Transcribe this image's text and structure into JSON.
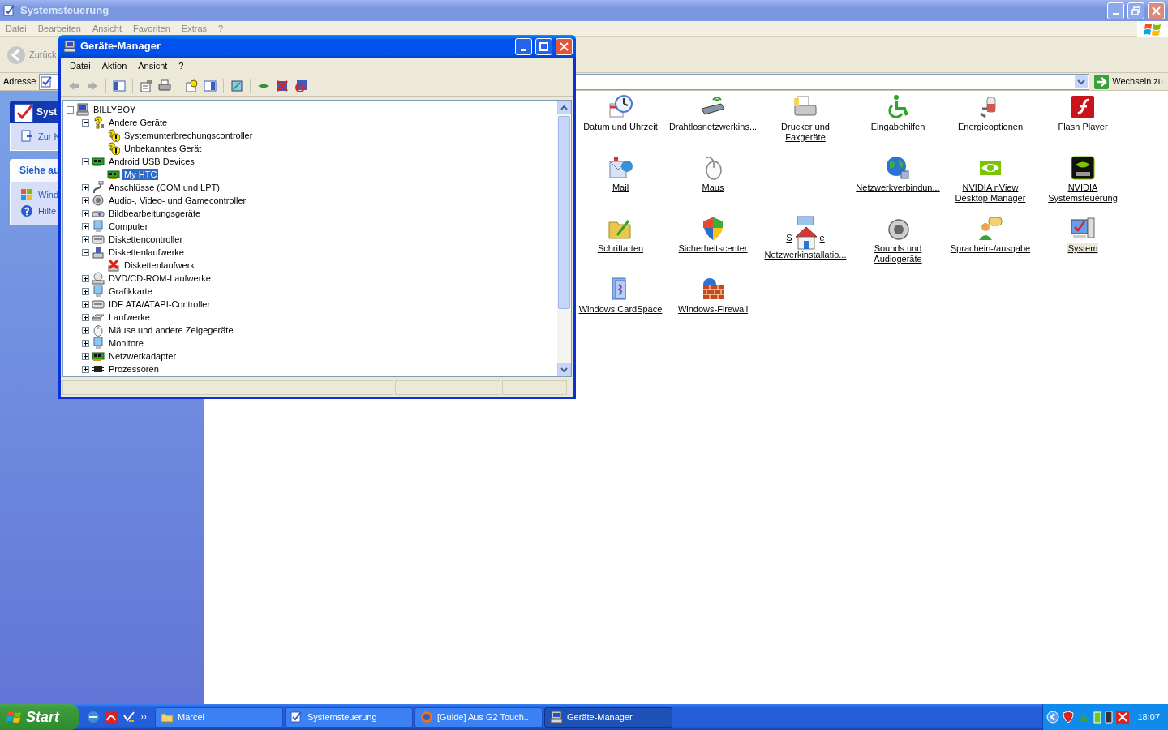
{
  "explorer": {
    "title": "Systemsteuerung",
    "menu": [
      "Datei",
      "Bearbeiten",
      "Ansicht",
      "Favoriten",
      "Extras",
      "?"
    ],
    "back_button": {
      "label": "Zurück",
      "disabled": true
    },
    "address": {
      "label": "Adresse",
      "go_button": "Wechseln zu"
    },
    "task_panes": [
      {
        "kind": "special",
        "title": "Syst",
        "links": [
          "Zur K"
        ]
      },
      {
        "kind": "normal",
        "title": "Siehe au",
        "links": [
          "Wind",
          "Hilfe"
        ]
      }
    ],
    "items": [
      {
        "kind": "item",
        "label": "Datum und Uhrzeit",
        "selected": false
      },
      {
        "kind": "item",
        "label": "Drahtlosnetzwerkins...",
        "selected": false
      },
      {
        "kind": "item",
        "label": "Drucker und Faxgeräte",
        "selected": false
      },
      {
        "kind": "item",
        "label": "Eingabehilfen",
        "selected": false
      },
      {
        "kind": "item",
        "label": "Energieoptionen",
        "selected": false
      },
      {
        "kind": "item",
        "label": "Flash Player",
        "selected": false
      },
      {
        "kind": "item",
        "label": "Mail",
        "selected": false
      },
      {
        "kind": "item",
        "label": "Maus",
        "selected": false
      },
      {
        "kind": "blank"
      },
      {
        "kind": "item",
        "label": "Netzwerkverbindun...",
        "selected": false
      },
      {
        "kind": "item",
        "label": "NVIDIA nView Desktop Manager",
        "selected": false
      },
      {
        "kind": "item",
        "label": "NVIDIA Systemsteuerung",
        "selected": false
      },
      {
        "kind": "item",
        "label": "Schriftarten",
        "selected": false
      },
      {
        "kind": "item",
        "label": "Sicherheitscenter",
        "selected": false
      },
      {
        "kind": "covered",
        "label_parts": [
          "S",
          "e"
        ],
        "caption": "Netzwerkinstallatio..."
      },
      {
        "kind": "item",
        "label": "Sounds und Audiogeräte",
        "selected": false
      },
      {
        "kind": "item",
        "label": "Sprachein-/ausgabe",
        "selected": false
      },
      {
        "kind": "item",
        "label": "System",
        "selected": true
      },
      {
        "kind": "item",
        "label": "Windows CardSpace",
        "selected": false
      },
      {
        "kind": "item",
        "label": "Windows-Firewall",
        "selected": false
      }
    ]
  },
  "device_manager": {
    "title": "Geräte-Manager",
    "menu": [
      "Datei",
      "Aktion",
      "Ansicht",
      "?"
    ],
    "nav_buttons": [
      {
        "disabled": true
      },
      {
        "disabled": true
      }
    ],
    "tree": {
      "label": "BILLYBOY",
      "kind": "computer",
      "expanded": true,
      "selected": false,
      "children": [
        {
          "label": "Andere Geräte",
          "kind": "unknown",
          "expanded": true,
          "selected": false,
          "children": [
            {
              "label": "Systemunterbrechungscontroller",
              "kind": "warning",
              "selected": false
            },
            {
              "label": "Unbekanntes Gerät",
              "kind": "warning",
              "selected": false
            }
          ]
        },
        {
          "label": "Android USB Devices",
          "kind": "board",
          "expanded": true,
          "selected": false,
          "children": [
            {
              "label": "My HTC",
              "kind": "board",
              "selected": true
            }
          ]
        },
        {
          "label": "Anschlüsse (COM und LPT)",
          "kind": "port",
          "expanded": false,
          "selected": false
        },
        {
          "label": "Audio-, Video- und Gamecontroller",
          "kind": "audio",
          "expanded": false,
          "selected": false
        },
        {
          "label": "Bildbearbeitungsgeräte",
          "kind": "camera",
          "expanded": false,
          "selected": false
        },
        {
          "label": "Computer",
          "kind": "monitor",
          "expanded": false,
          "selected": false
        },
        {
          "label": "Diskettencontroller",
          "kind": "controller",
          "expanded": false,
          "selected": false
        },
        {
          "label": "Diskettenlaufwerke",
          "kind": "floppy",
          "expanded": true,
          "selected": false,
          "children": [
            {
              "label": "Diskettenlaufwerk",
              "kind": "disabled",
              "selected": false
            }
          ]
        },
        {
          "label": "DVD/CD-ROM-Laufwerke",
          "kind": "disc",
          "expanded": false,
          "selected": false
        },
        {
          "label": "Grafikkarte",
          "kind": "monitor",
          "expanded": false,
          "selected": false
        },
        {
          "label": "IDE ATA/ATAPI-Controller",
          "kind": "controller",
          "expanded": false,
          "selected": false
        },
        {
          "label": "Laufwerke",
          "kind": "drive",
          "expanded": false,
          "selected": false
        },
        {
          "label": "Mäuse und andere Zeigegeräte",
          "kind": "mouse",
          "expanded": false,
          "selected": false
        },
        {
          "label": "Monitore",
          "kind": "monitor",
          "expanded": false,
          "selected": false
        },
        {
          "label": "Netzwerkadapter",
          "kind": "board",
          "expanded": false,
          "selected": false
        },
        {
          "label": "Prozessoren",
          "kind": "chip",
          "expanded": false,
          "selected": false
        }
      ]
    }
  },
  "taskbar": {
    "start": "Start",
    "tasks": [
      {
        "label": "Marcel",
        "kind": "folder",
        "selected": false
      },
      {
        "label": "Systemsteuerung",
        "kind": "panel",
        "selected": false
      },
      {
        "label": "[Guide] Aus G2 Touch...",
        "kind": "browser",
        "selected": false
      },
      {
        "label": "Geräte-Manager",
        "kind": "computer",
        "selected": true
      }
    ],
    "clock": "18:07"
  }
}
